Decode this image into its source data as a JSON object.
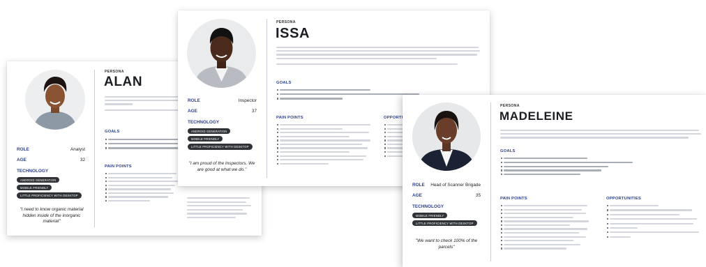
{
  "colors": {
    "accent": "#2b3f8f",
    "chip_bg": "#2f3236",
    "card_bg": "#ffffff"
  },
  "alan": {
    "persona_label": "PERSONA",
    "name": "ALAN",
    "role_label": "ROLE",
    "role": "Analyst",
    "age_label": "AGE",
    "age": "32",
    "technology_label": "TECHNOLOGY",
    "chips": [
      "ANDROID GENERATION",
      "MOBILE FRIENDLY",
      "LITTLE PROFICIENCY WITH DESKTOP"
    ],
    "quote": "\"I need to know organic material hidden inside of the inorganic material\"",
    "goals_label": "GOALS",
    "pain_points_label": "PAIN POINTS"
  },
  "issa": {
    "persona_label": "PERSONA",
    "name": "ISSA",
    "role_label": "ROLE",
    "role": "Inspector",
    "age_label": "AGE",
    "age": "37",
    "technology_label": "TECHNOLOGY",
    "chips": [
      "ANDROID GENERATION",
      "MOBILE FRIENDLY",
      "LITTLE PROFICIENCY WITH DESKTOP"
    ],
    "quote": "\"I am proud of the Inspectors. We are good at what we do.\"",
    "goals_label": "GOALS",
    "pain_points_label": "PAIN POINTS",
    "opportunities_label": "OPPORTU"
  },
  "madeleine": {
    "persona_label": "PERSONA",
    "name": "MADELEINE",
    "role_label": "ROLE",
    "role": "Head of Scanner Brigade",
    "age_label": "AGE",
    "age": "35",
    "technology_label": "TECHNOLOGY",
    "chips": [
      "MOBILE FRIENDLY",
      "LITTLE PROFICIENCY WITH DESKTOP"
    ],
    "quote": "\"We want to check 100% of the parcels\"",
    "goals_label": "GOALS",
    "pain_points_label": "PAIN POINTS",
    "opportunities_label": "OPPORTUNITIES"
  }
}
